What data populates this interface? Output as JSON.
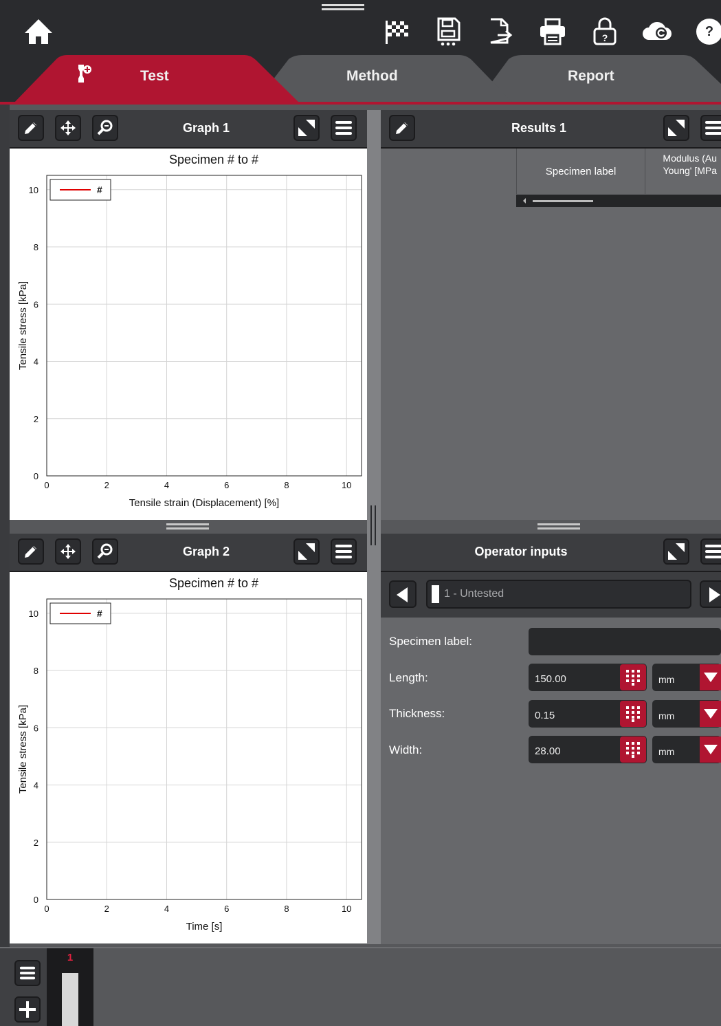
{
  "tabs": [
    {
      "label": "Test",
      "active": true
    },
    {
      "label": "Method",
      "active": false
    },
    {
      "label": "Report",
      "active": false
    }
  ],
  "toolbar_icons": [
    "home-icon",
    "finish-flag-icon",
    "save-icon",
    "export-icon",
    "print-icon",
    "lock-icon",
    "cloud-icon",
    "help-icon"
  ],
  "help_glyph": "?",
  "colors": {
    "accent": "#b01531",
    "dark": "#2a2b2e",
    "panel": "#3c3d40"
  },
  "graph1": {
    "title": "Graph 1",
    "chart_title": "Specimen # to #",
    "legend": "#",
    "xlabel": "Tensile strain (Displacement) [%]",
    "ylabel": "Tensile stress [kPa]"
  },
  "graph2": {
    "title": "Graph 2",
    "chart_title": "Specimen # to #",
    "legend": "#",
    "xlabel": "Time [s]",
    "ylabel": "Tensile stress [kPa]"
  },
  "results": {
    "title": "Results 1",
    "columns": [
      "",
      "Specimen label",
      "Modulus (Au Young' [MPa"
    ]
  },
  "operator": {
    "title": "Operator inputs",
    "specimen_selector": "1 - Untested",
    "fields": [
      {
        "label": "Specimen label:",
        "value": "",
        "unit": ""
      },
      {
        "label": "Length:",
        "value": "150.00",
        "unit": "mm"
      },
      {
        "label": "Thickness:",
        "value": "0.15",
        "unit": "mm"
      },
      {
        "label": "Width:",
        "value": "28.00",
        "unit": "mm"
      }
    ]
  },
  "specimen_strip": {
    "number": "1"
  },
  "chart_data": [
    {
      "type": "line",
      "title": "Specimen # to #",
      "xlabel": "Tensile strain (Displacement) [%]",
      "ylabel": "Tensile stress [kPa]",
      "xlim": [
        0,
        10.5
      ],
      "ylim": [
        0,
        10.5
      ],
      "xticks": [
        0,
        2,
        4,
        6,
        8,
        10
      ],
      "yticks": [
        0,
        2,
        4,
        6,
        8,
        10
      ],
      "grid": true,
      "legend_position": "top-left",
      "series": [
        {
          "name": "#",
          "color": "#e00000",
          "x": [],
          "y": []
        }
      ]
    },
    {
      "type": "line",
      "title": "Specimen # to #",
      "xlabel": "Time [s]",
      "ylabel": "Tensile stress [kPa]",
      "xlim": [
        0,
        10.5
      ],
      "ylim": [
        0,
        10.5
      ],
      "xticks": [
        0,
        2,
        4,
        6,
        8,
        10
      ],
      "yticks": [
        0,
        2,
        4,
        6,
        8,
        10
      ],
      "grid": true,
      "legend_position": "top-left",
      "series": [
        {
          "name": "#",
          "color": "#e00000",
          "x": [],
          "y": []
        }
      ]
    }
  ]
}
